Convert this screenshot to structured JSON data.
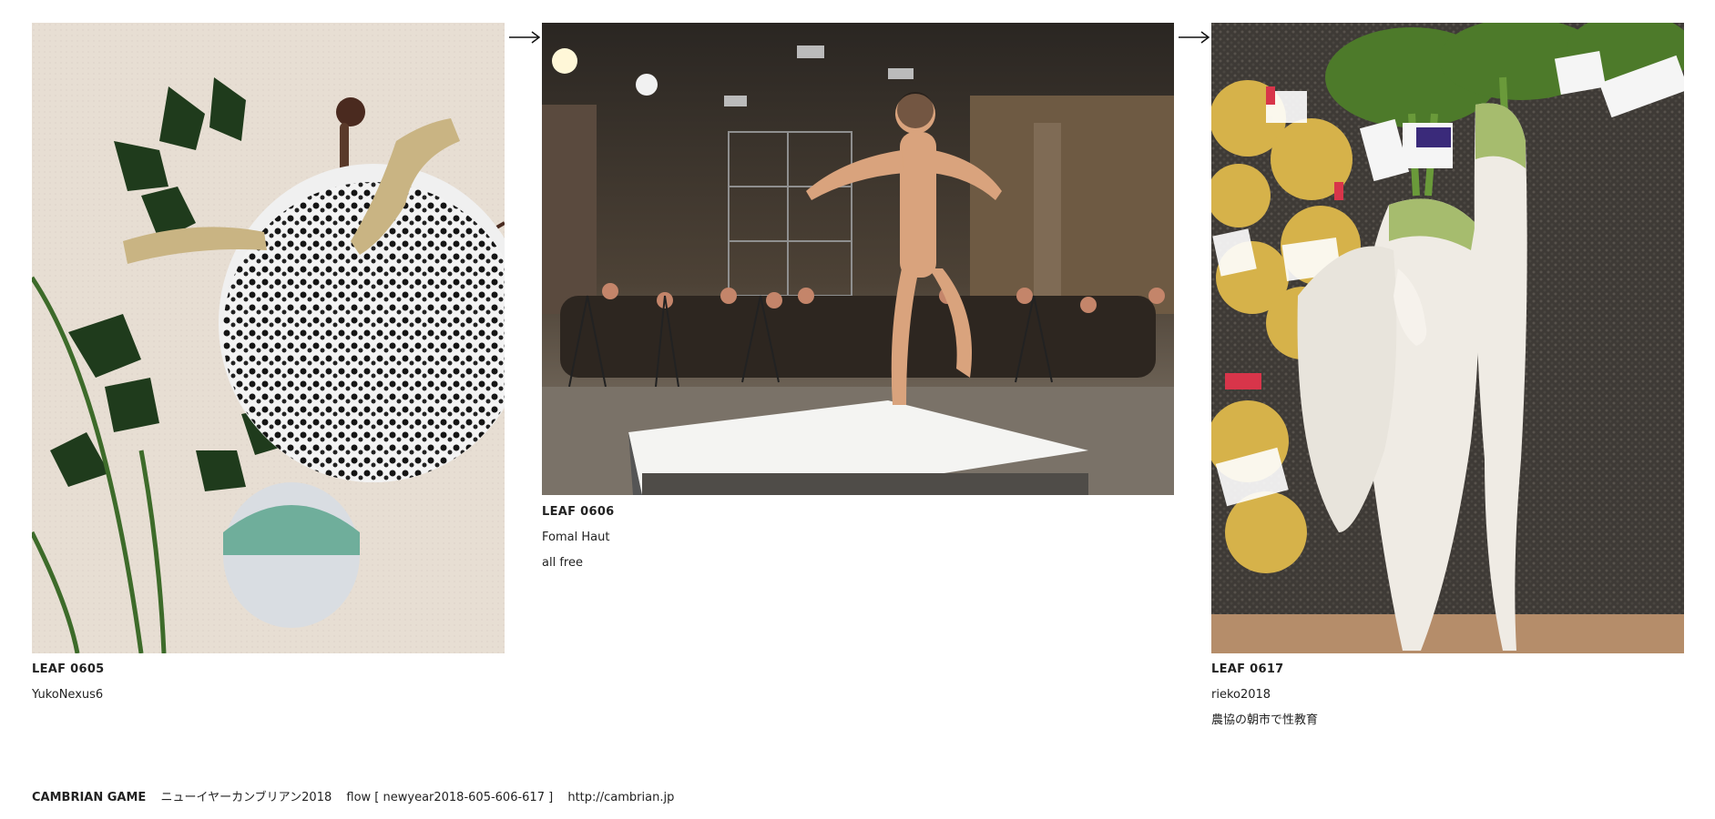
{
  "leaves": [
    {
      "code": "LEAF 0605",
      "author": "YukoNexus6",
      "note": "",
      "image": "ceramic-mask-with-holly-and-driftwood-horns"
    },
    {
      "code": "LEAF 0606",
      "author": "Fomal Haut",
      "note": "all free",
      "image": "nude-dancer-on-white-stage-with-photographers"
    },
    {
      "code": "LEAF 0617",
      "author": "rieko2018",
      "note": "農協の朝市で性教育",
      "image": "daikon-radishes-and-yuzu-bags"
    }
  ],
  "arrows": [
    "→",
    "→"
  ],
  "footer": {
    "brand": "CAMBRIAN GAME",
    "title": "ニューイヤーカンブリアン2018",
    "flow": "flow [ newyear2018-605-606-617 ]",
    "url": "http://cambrian.jp"
  },
  "colors": {
    "background": "#ffffff",
    "text": "#222222"
  }
}
